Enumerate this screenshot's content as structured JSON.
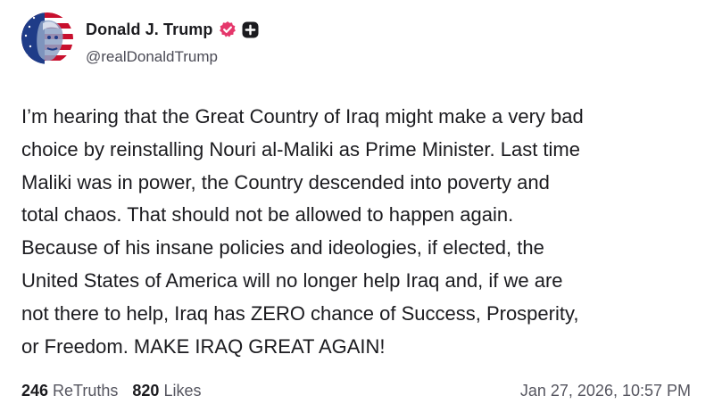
{
  "author": {
    "display_name": "Donald J. Trump",
    "handle": "@realDonaldTrump"
  },
  "badges": {
    "verified_icon": "verified-badge-icon",
    "plus_icon": "plus-badge-icon",
    "verified_color": "#e5376b",
    "plus_color": "#1b1b1f"
  },
  "post": {
    "text": "I’m hearing that the Great Country of Iraq might make a very bad\nchoice by reinstalling Nouri al-Maliki as Prime Minister. Last time\nMaliki was in power, the Country descended into poverty and\ntotal chaos. That should not be allowed to happen again.\nBecause of his insane policies and ideologies, if elected, the\nUnited States of America will no longer help Iraq and, if we are\nnot there to help, Iraq has ZERO chance of Success, Prosperity,\nor Freedom. MAKE IRAQ GREAT AGAIN!"
  },
  "footer": {
    "retruths_count": "246",
    "retruths_label": "ReTruths",
    "likes_count": "820",
    "likes_label": "Likes",
    "timestamp": "Jan 27, 2026, 10:57 PM"
  }
}
